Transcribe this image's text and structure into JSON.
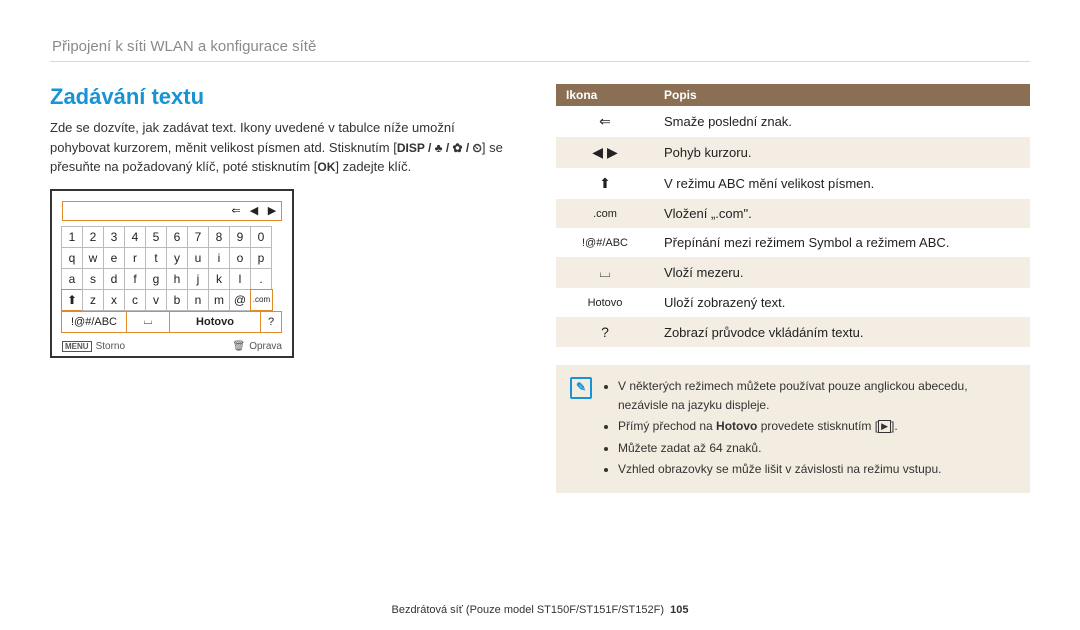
{
  "header": {
    "section": "Připojení k síti WLAN a konfigurace sítě"
  },
  "left": {
    "title": "Zadávání textu",
    "para_a": "Zde se dozvíte, jak zadávat text. Ikony uvedené v tabulce níže umožní pohybovat kurzorem, měnit velikost písmen atd. Stisknutím [",
    "para_icons": "DISP / ♣ / ✿ / ⏲",
    "para_b": "] se přesuňte na požadovaný klíč, poté stisknutím [",
    "para_ok": "OK",
    "para_c": "] zadejte klíč."
  },
  "keyboard": {
    "top_arrows": [
      "⇐",
      "◀",
      "▶"
    ],
    "rows": [
      [
        "1",
        "2",
        "3",
        "4",
        "5",
        "6",
        "7",
        "8",
        "9",
        "0"
      ],
      [
        "q",
        "w",
        "e",
        "r",
        "t",
        "y",
        "u",
        "i",
        "o",
        "p"
      ],
      [
        "a",
        "s",
        "d",
        "f",
        "g",
        "h",
        "j",
        "k",
        "l",
        "."
      ]
    ],
    "row4_shift": "⬆",
    "row4_keys": [
      "z",
      "x",
      "c",
      "v",
      "b",
      "n",
      "m"
    ],
    "row4_at": "@",
    "row4_com": ".com",
    "bottom": {
      "mode": "!@#/ABC",
      "space": "⌴",
      "done": "Hotovo",
      "help": "?"
    },
    "footer": {
      "menu_badge": "MENU",
      "storno": "Storno",
      "trash": "🗑",
      "oprava": "Oprava"
    }
  },
  "table": {
    "head_icon": "Ikona",
    "head_desc": "Popis",
    "rows": [
      {
        "icon": "⇐",
        "cls": "",
        "text": "Smaže poslední znak."
      },
      {
        "icon": "◀ ▶",
        "cls": "",
        "text": "Pohyb kurzoru."
      },
      {
        "icon": "⬆",
        "cls": "",
        "text": "V režimu ABC mění velikost písmen."
      },
      {
        "icon": ".com",
        "cls": "icon-small",
        "text": "Vložení „.com\"."
      },
      {
        "icon": "!@#/ABC",
        "cls": "icon-small",
        "text": "Přepínání mezi režimem Symbol a režimem ABC."
      },
      {
        "icon": "⌴",
        "cls": "",
        "text": "Vloží mezeru."
      },
      {
        "icon": "Hotovo",
        "cls": "icon-small",
        "text": "Uloží zobrazený text."
      },
      {
        "icon": "?",
        "cls": "",
        "text": "Zobrazí průvodce vkládáním textu."
      }
    ]
  },
  "note": {
    "items": [
      "V některých režimech můžete používat pouze anglickou abecedu, nezávisle na jazyku displeje.",
      "Přímý přechod na <b>Hotovo</b> provedete stisknutím [<span class=\"play-box\">▶</span>].",
      "Můžete zadat až 64 znaků.",
      "Vzhled obrazovky se může lišit v závislosti na režimu vstupu."
    ]
  },
  "footer": {
    "text": "Bezdrátová síť (Pouze model ST150F/ST151F/ST152F)",
    "page": "105"
  }
}
